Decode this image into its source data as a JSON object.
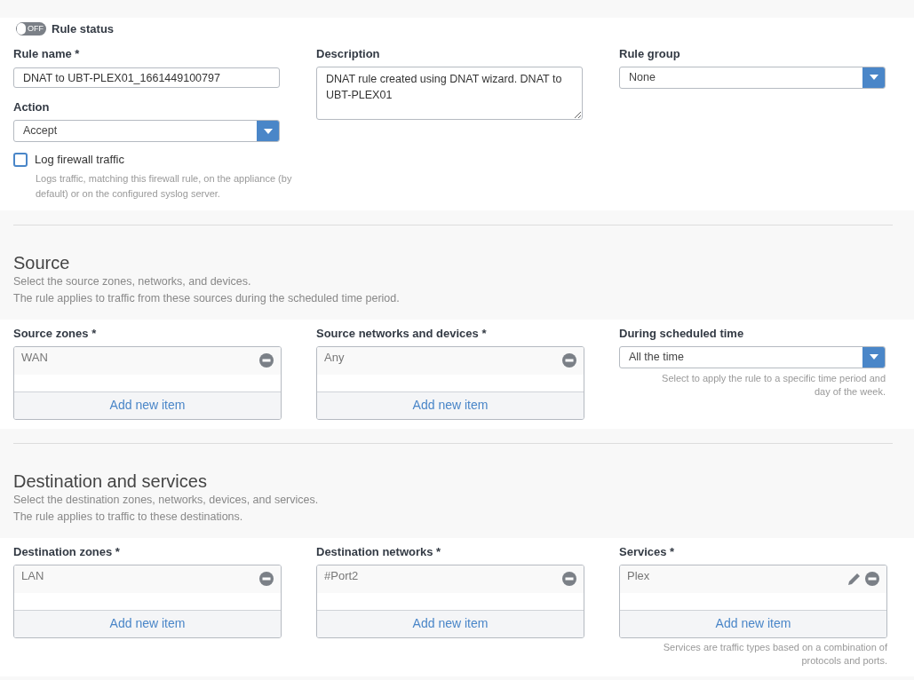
{
  "rule_status": {
    "toggle_label": "OFF",
    "on": false,
    "label": "Rule status"
  },
  "sections": [
    {
      "columns": [
        [
          {
            "kind": "text",
            "label": "Rule name *",
            "value": "DNAT to UBT-PLEX01_1661449100797"
          },
          {
            "kind": "select",
            "label": "Action",
            "value": "Accept"
          },
          {
            "kind": "checkbox",
            "label": "Log firewall traffic",
            "checked": false,
            "hint": "Logs traffic, matching this firewall rule, on the appliance (by default) or on the configured syslog server."
          }
        ],
        [
          {
            "kind": "textarea",
            "label": "Description",
            "value": "DNAT rule created using DNAT wizard. DNAT to UBT-PLEX01"
          }
        ],
        [
          {
            "kind": "select",
            "label": "Rule group",
            "value": "None"
          }
        ]
      ]
    },
    {
      "title": "Source",
      "description": [
        "Select the source zones, networks, and devices.",
        "The rule applies to traffic from these sources during the scheduled time period."
      ],
      "columns": [
        [
          {
            "kind": "list",
            "label": "Source zones *",
            "items": [
              {
                "text": "WAN",
                "editable": false
              }
            ],
            "add_label": "Add new item"
          }
        ],
        [
          {
            "kind": "list",
            "label": "Source networks and devices *",
            "items": [
              {
                "text": "Any",
                "editable": false
              }
            ],
            "add_label": "Add new item"
          }
        ],
        [
          {
            "kind": "select",
            "label": "During scheduled time",
            "value": "All the time",
            "hint": "Select to apply the rule to a specific time period and day of the week."
          }
        ]
      ]
    },
    {
      "title": "Destination and services",
      "description": [
        "Select the destination zones, networks, devices, and services.",
        "The rule applies to traffic to these destinations."
      ],
      "columns": [
        [
          {
            "kind": "list",
            "label": "Destination zones *",
            "items": [
              {
                "text": "LAN",
                "editable": false
              }
            ],
            "add_label": "Add new item"
          }
        ],
        [
          {
            "kind": "list",
            "label": "Destination networks *",
            "items": [
              {
                "text": "#Port2",
                "editable": false
              }
            ],
            "add_label": "Add new item"
          }
        ],
        [
          {
            "kind": "list",
            "label": "Services *",
            "items": [
              {
                "text": "Plex",
                "editable": true
              }
            ],
            "add_label": "Add new item",
            "hint": "Services are traffic types based on a combination of protocols and ports."
          }
        ]
      ]
    }
  ]
}
